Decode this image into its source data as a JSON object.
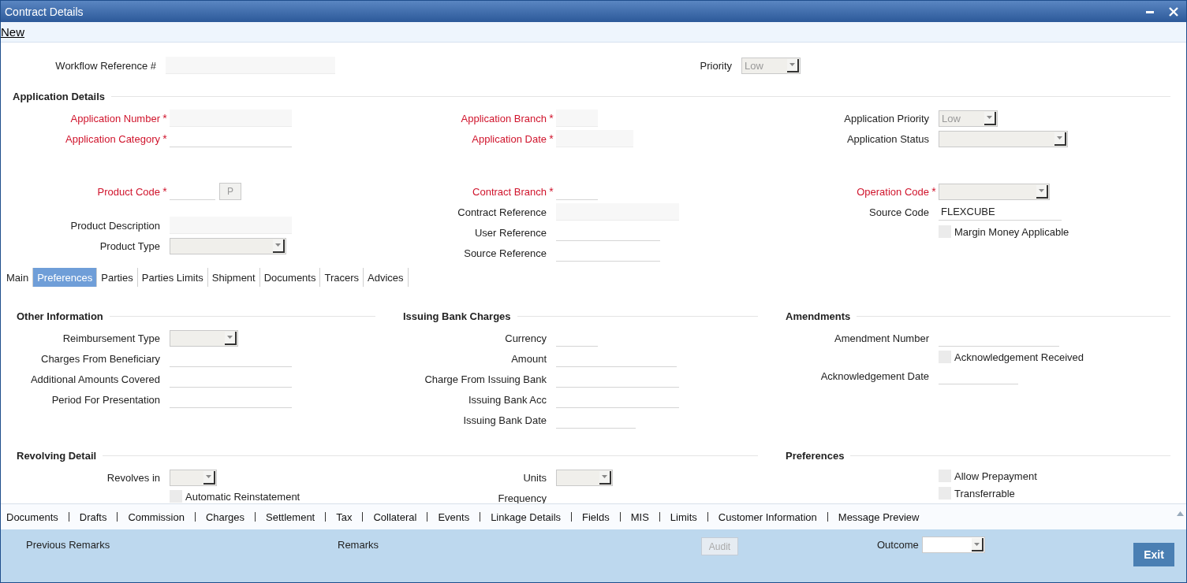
{
  "window": {
    "title": "Contract Details"
  },
  "toolbar": {
    "link": "New"
  },
  "header_fields": [
    {
      "label": "Workflow Reference #",
      "kind": "readonly",
      "required": false
    },
    {
      "label": "Priority",
      "kind": "select",
      "required": false,
      "value": "Low"
    }
  ],
  "application_details": {
    "title": "Application Details",
    "columns": [
      [
        {
          "label": "Application Number",
          "kind": "readonly",
          "required": true,
          "mark": "*"
        },
        {
          "label": "Application Category",
          "kind": "text",
          "required": true,
          "mark": "*"
        }
      ],
      [
        {
          "label": "Application Branch",
          "kind": "readonly",
          "required": true,
          "mark": "*"
        },
        {
          "label": "Application Date",
          "kind": "readonly",
          "required": true,
          "mark": "*"
        }
      ],
      [
        {
          "label": "Application Priority",
          "kind": "select",
          "required": false,
          "value": "Low"
        },
        {
          "label": "Application Status",
          "kind": "select",
          "required": false
        }
      ]
    ]
  },
  "product": {
    "columns": [
      [
        {
          "label": "Product Code",
          "kind": "lookup",
          "required": true,
          "mark": "*",
          "button": "P"
        },
        {
          "label": "Product Description",
          "kind": "readonly",
          "required": false
        },
        {
          "label": "Product Type",
          "kind": "select",
          "required": false
        }
      ],
      [
        {
          "label": "Contract Branch",
          "kind": "text",
          "required": true,
          "mark": "*"
        },
        {
          "label": "Contract Reference",
          "kind": "readonly",
          "required": false
        },
        {
          "label": "User Reference",
          "kind": "text",
          "required": false
        },
        {
          "label": "Source Reference",
          "kind": "text",
          "required": false
        }
      ],
      [
        {
          "label": "Operation Code",
          "kind": "select",
          "required": true,
          "mark": "*"
        },
        {
          "label": "Source Code",
          "kind": "text",
          "required": false,
          "value": "FLEXCUBE"
        },
        {
          "label": "Margin Money Applicable",
          "kind": "checkbox",
          "checked": false
        }
      ]
    ]
  },
  "tabs": [
    {
      "label": "Main",
      "selected": false
    },
    {
      "label": "Preferences",
      "selected": true
    },
    {
      "label": "Parties",
      "selected": false
    },
    {
      "label": "Parties Limits",
      "selected": false
    },
    {
      "label": "Shipment",
      "selected": false
    },
    {
      "label": "Documents",
      "selected": false
    },
    {
      "label": "Tracers",
      "selected": false
    },
    {
      "label": "Advices",
      "selected": false
    }
  ],
  "section_rows": [
    [
      {
        "title": "Other Information",
        "columns": [
          [
            {
              "label": "Reimbursement Type",
              "kind": "select",
              "required": false
            },
            {
              "label": "Charges From Beneficiary",
              "kind": "text",
              "required": false
            },
            {
              "label": "Additional Amounts Covered",
              "kind": "text",
              "required": false
            },
            {
              "label": "Period For Presentation",
              "kind": "text",
              "required": false
            }
          ]
        ]
      },
      {
        "title": "Issuing Bank Charges",
        "columns": [
          [
            {
              "label": "Currency",
              "kind": "text",
              "required": false
            },
            {
              "label": "Amount",
              "kind": "text",
              "required": false
            },
            {
              "label": "Charge From Issuing Bank",
              "kind": "text",
              "required": false
            },
            {
              "label": "Issuing Bank Acc",
              "kind": "text",
              "required": false
            },
            {
              "label": "Issuing Bank Date",
              "kind": "text",
              "required": false
            }
          ]
        ]
      },
      {
        "title": "Amendments",
        "columns": [
          [
            {
              "label": "Amendment Number",
              "kind": "text",
              "required": false
            },
            {
              "label": "Acknowledgement Received",
              "kind": "checkbox",
              "checked": false
            },
            {
              "label": "Acknowledgement Date",
              "kind": "text",
              "required": false
            }
          ]
        ]
      }
    ],
    [
      {
        "title": "Revolving Detail",
        "columns": [
          [
            {
              "label": "Revolves in",
              "kind": "select",
              "required": false
            },
            {
              "label": "Automatic Reinstatement",
              "kind": "checkbox",
              "checked": false
            }
          ],
          [
            {
              "label": "Units",
              "kind": "select",
              "required": false
            },
            {
              "label": "Frequency",
              "kind": "label",
              "required": false
            }
          ]
        ]
      },
      {
        "title": "Preferences",
        "columns": [
          [
            {
              "label": "Allow Prepayment",
              "kind": "checkbox",
              "checked": false
            },
            {
              "label": "Transferrable",
              "kind": "checkbox",
              "checked": false
            }
          ]
        ]
      }
    ]
  ],
  "footer_links": [
    "Documents",
    "Drafts",
    "Commission",
    "Charges",
    "Settlement",
    "Tax",
    "Collateral",
    "Events",
    "Linkage Details",
    "Fields",
    "MIS",
    "Limits",
    "Customer Information",
    "Message Preview"
  ],
  "bottom_panel": {
    "previous_remarks": "Previous Remarks",
    "remarks": "Remarks",
    "audit_button": "Audit",
    "outcome_label": "Outcome",
    "exit_button": "Exit"
  }
}
